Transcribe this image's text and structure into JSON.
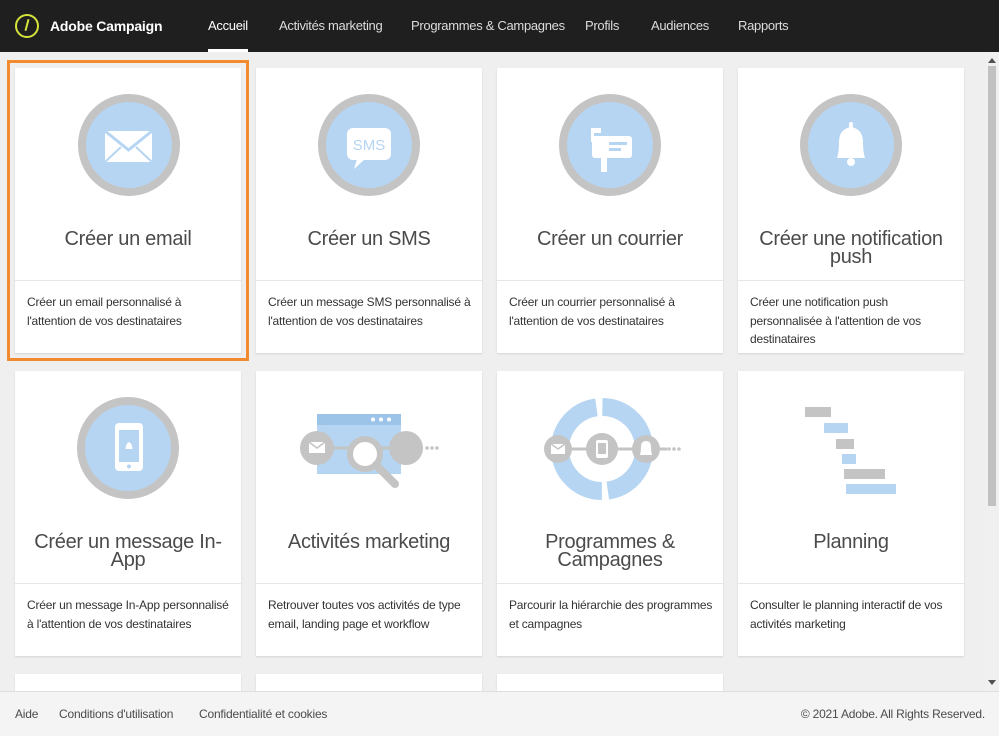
{
  "app": {
    "name": "Adobe Campaign"
  },
  "nav": {
    "tabs": [
      {
        "label": "Accueil",
        "active": true
      },
      {
        "label": "Activités marketing"
      },
      {
        "label": "Programmes & Campagnes"
      },
      {
        "label": "Profils"
      },
      {
        "label": "Audiences"
      },
      {
        "label": "Rapports"
      }
    ]
  },
  "cards": [
    {
      "icon": "email-icon",
      "title": "Créer un email",
      "description": "Créer un email personnalisé à l'attention de vos destinataires",
      "selected": true
    },
    {
      "icon": "sms-icon",
      "title": "Créer un SMS",
      "sms_label": "SMS",
      "description": "Créer un message SMS personnalisé à l'attention de vos destinataires"
    },
    {
      "icon": "mailbox-icon",
      "title": "Créer un courrier",
      "description": "Créer un courrier personnalisé à l'attention de vos destinataires"
    },
    {
      "icon": "bell-icon",
      "title": "Créer une notification push",
      "description": "Créer une notification push personnalisée à l'attention de vos destinataires"
    },
    {
      "icon": "mobile-app-icon",
      "title": "Créer un message In-App",
      "description": "Créer un message In-App personnalisé à l'attention de vos destinataires"
    },
    {
      "icon": "marketing-activities-icon",
      "title": "Activités marketing",
      "description": "Retrouver toutes vos activités de type email, landing page et workflow"
    },
    {
      "icon": "programs-campaigns-icon",
      "title": "Programmes & Campagnes",
      "description": "Parcourir la hiérarchie des programmes et campagnes"
    },
    {
      "icon": "planning-gantt-icon",
      "title": "Planning",
      "description": "Consulter le planning interactif de vos activités marketing"
    }
  ],
  "footer": {
    "links": [
      "Aide",
      "Conditions d'utilisation",
      "Confidentialité et cookies"
    ],
    "copyright": "© 2021 Adobe. All Rights Reserved."
  },
  "colors": {
    "topbar": "#1f1f1f",
    "accent_selected": "#f28b30",
    "icon_light_blue": "#b6d5f2",
    "icon_gray": "#c4c4c4",
    "logo": "#d6e43a"
  }
}
